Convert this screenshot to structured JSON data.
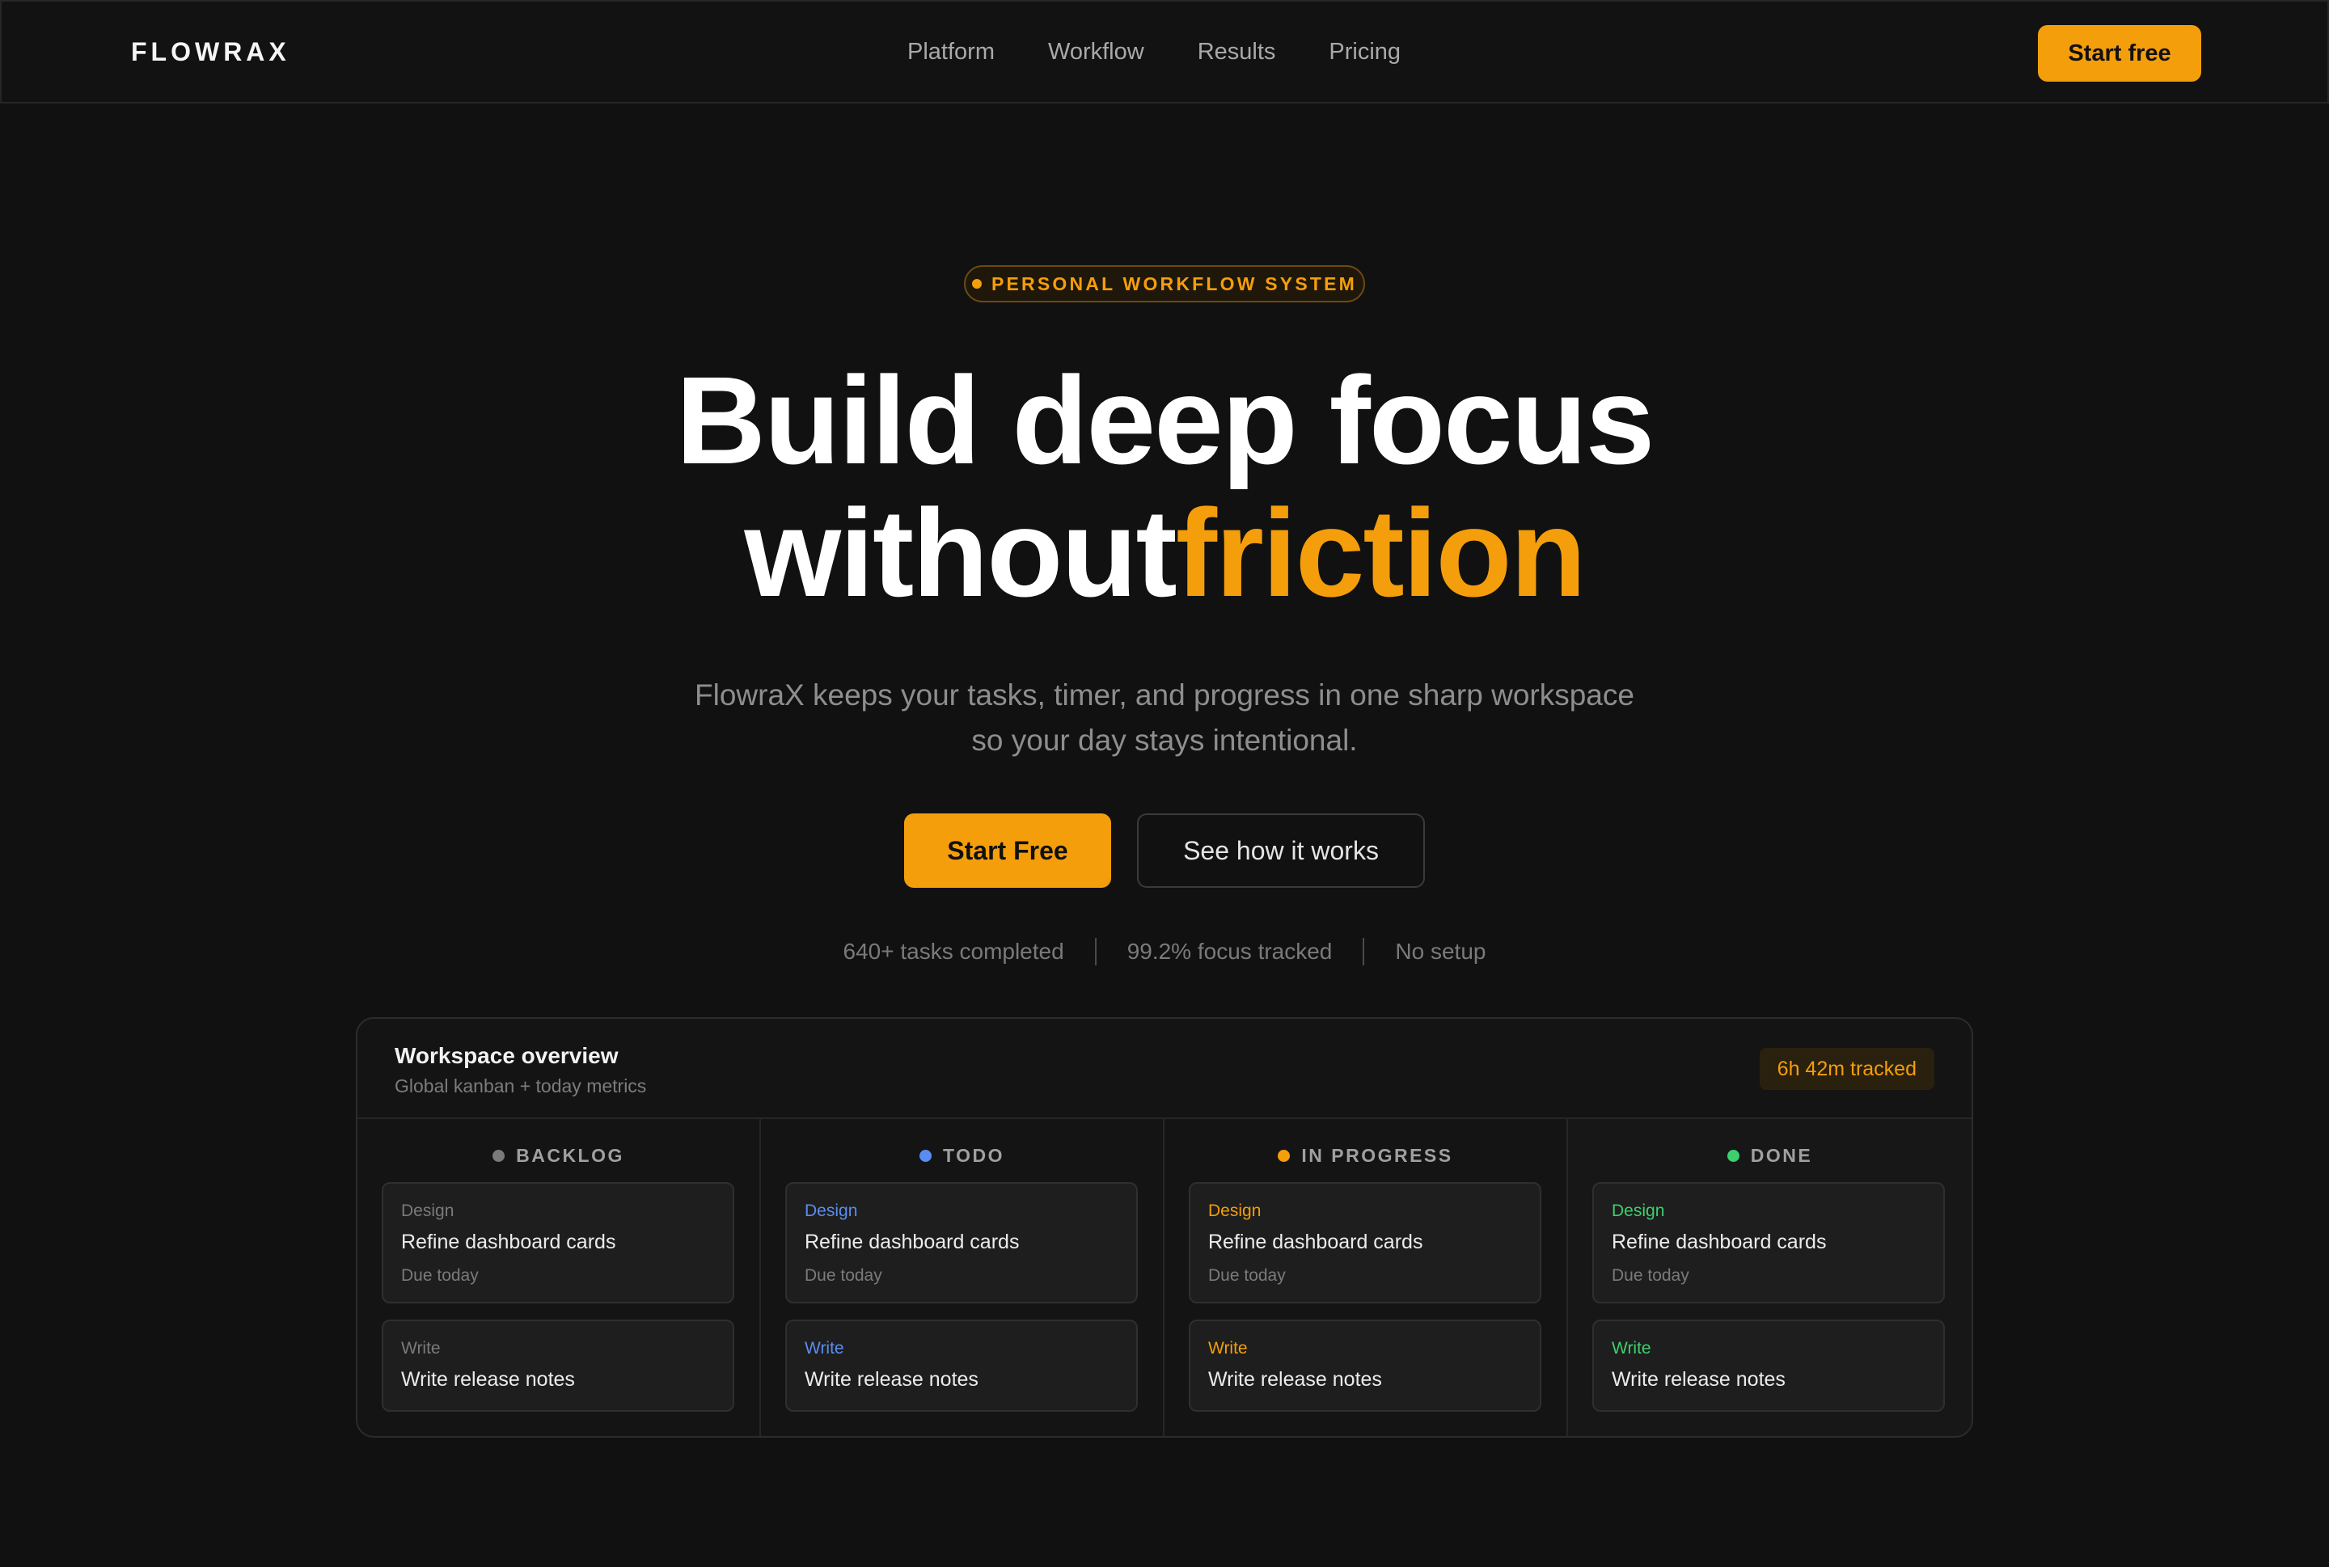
{
  "nav": {
    "logo": "FLOWRAX",
    "links": [
      "Platform",
      "Workflow",
      "Results",
      "Pricing"
    ],
    "cta": "Start free"
  },
  "hero": {
    "badge": "PERSONAL WORKFLOW SYSTEM",
    "headline_line1": "Build deep focus",
    "headline_line2_plain": "without",
    "headline_line2_accent": "friction",
    "subtitle_line1": "FlowraX keeps your tasks, timer, and progress in one sharp workspace",
    "subtitle_line2": "so your day stays intentional.",
    "primary_cta": "Start Free",
    "secondary_cta": "See how it works",
    "stats": [
      "640+ tasks completed",
      "99.2% focus tracked",
      "No setup"
    ]
  },
  "workspace": {
    "title": "Workspace overview",
    "subtitle": "Global kanban + today metrics",
    "tracked": "6h 42m tracked",
    "columns": [
      {
        "label": "BACKLOG",
        "color": "#7a7a7a",
        "cards": [
          {
            "tag": "Design",
            "title": "Refine dashboard cards",
            "due": "Due today"
          },
          {
            "tag": "Write",
            "title": "Write release notes"
          }
        ]
      },
      {
        "label": "TODO",
        "color": "#5b8def",
        "cards": [
          {
            "tag": "Design",
            "title": "Refine dashboard cards",
            "due": "Due today"
          },
          {
            "tag": "Write",
            "title": "Write release notes"
          }
        ]
      },
      {
        "label": "IN PROGRESS",
        "color": "#f59e0b",
        "cards": [
          {
            "tag": "Design",
            "title": "Refine dashboard cards",
            "due": "Due today"
          },
          {
            "tag": "Write",
            "title": "Write release notes"
          }
        ]
      },
      {
        "label": "DONE",
        "color": "#3ecf6e",
        "cards": [
          {
            "tag": "Design",
            "title": "Refine dashboard cards",
            "due": "Due today"
          },
          {
            "tag": "Write",
            "title": "Write release notes"
          }
        ]
      }
    ]
  },
  "colors": {
    "accent": "#f59e0b",
    "background": "#111111"
  }
}
